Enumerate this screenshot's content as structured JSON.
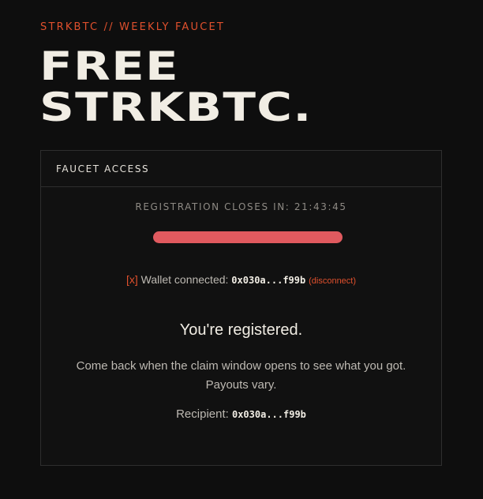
{
  "header": {
    "eyebrow": "STRKBTC // WEEKLY FAUCET",
    "title_line1": "FREE",
    "title_line2": "STRKBTC."
  },
  "card": {
    "title": "FAUCET ACCESS",
    "countdown_label": "REGISTRATION CLOSES IN:",
    "countdown_value": "21:43:45",
    "wallet": {
      "marker": "[x]",
      "label": "Wallet connected:",
      "address": "0x030a...f99b",
      "disconnect_label": "(disconnect)"
    },
    "status": "You're registered.",
    "message_line1": "Come back when the claim window opens to see what you got.",
    "message_line2": "Payouts vary.",
    "recipient_label": "Recipient:",
    "recipient_address": "0x030a...f99b"
  },
  "colors": {
    "background": "#0e0e0e",
    "accent": "#e0502d",
    "redaction": "#e05a5f",
    "text": "#f1ede4"
  }
}
